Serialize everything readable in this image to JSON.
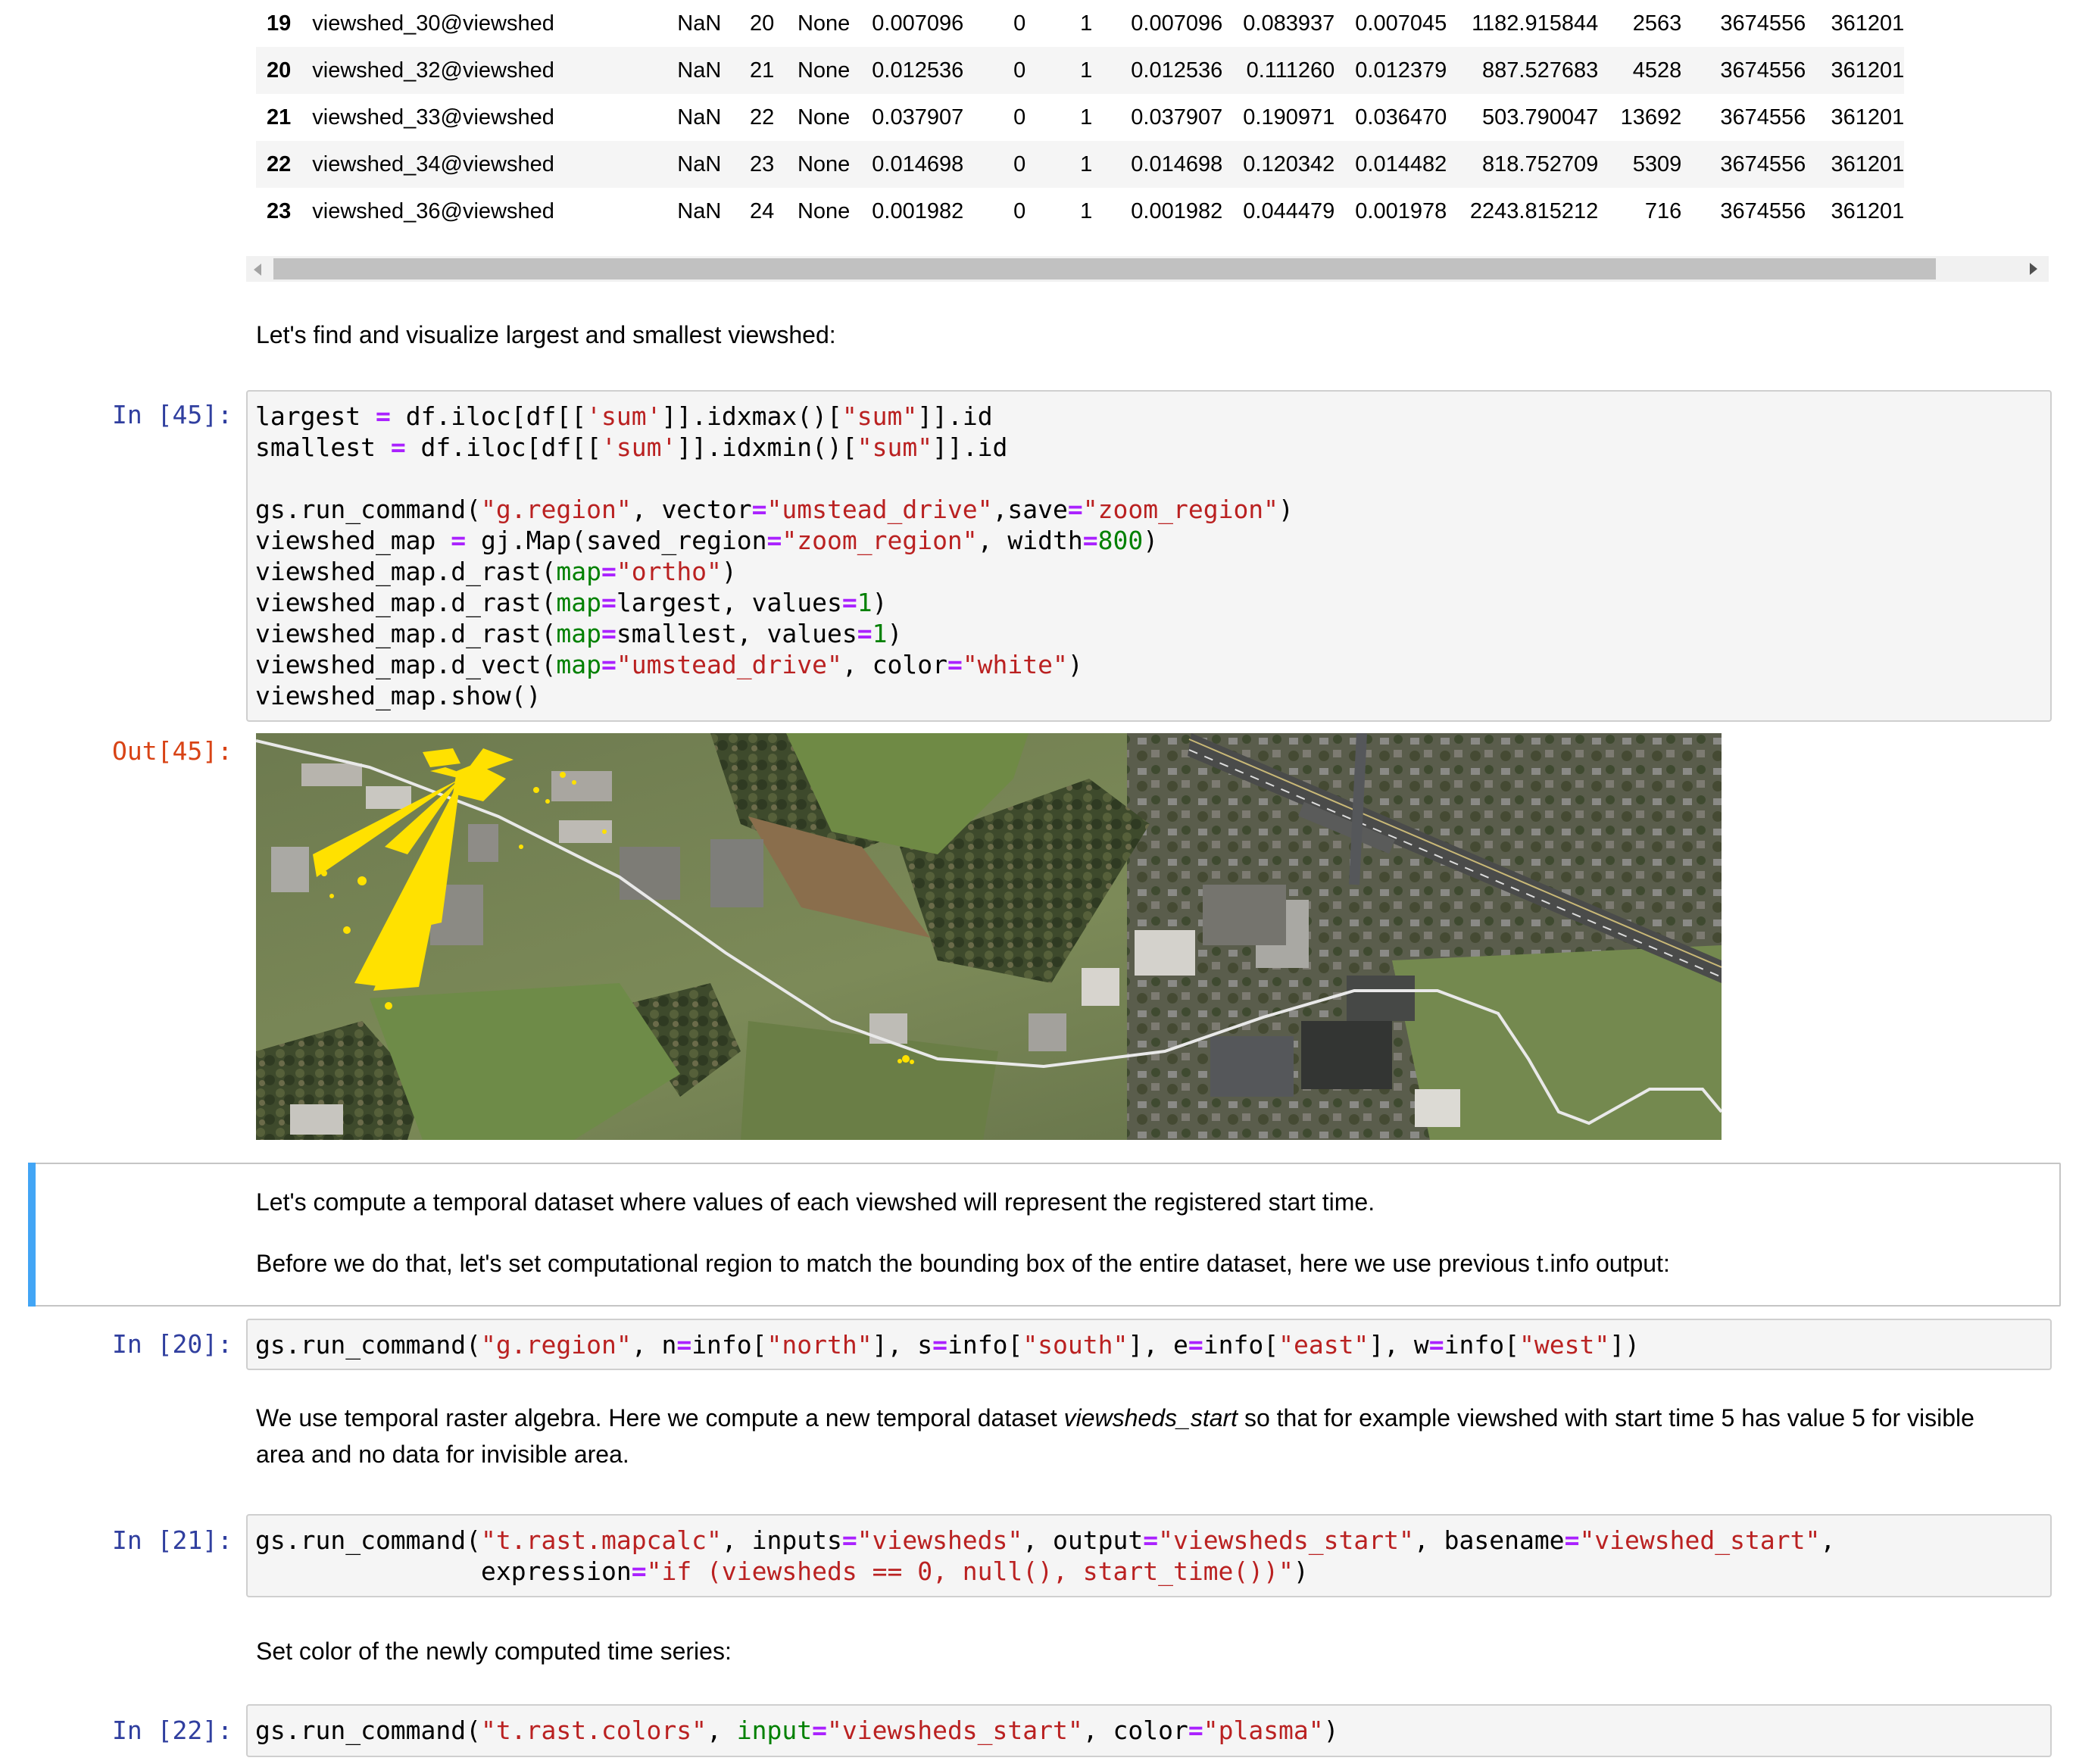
{
  "table": {
    "rows": [
      {
        "idx": "19",
        "name": "viewshed_30@viewshed",
        "c1": "NaN",
        "c2": "20",
        "c3": "None",
        "c4": "0.007096",
        "c5": "0",
        "c6": "1",
        "c7": "0.007096",
        "c8": "0.083937",
        "c9": "0.007045",
        "c10": "1182.915844",
        "c11": "2563",
        "c12": "3674556",
        "c13": "361201"
      },
      {
        "idx": "20",
        "name": "viewshed_32@viewshed",
        "c1": "NaN",
        "c2": "21",
        "c3": "None",
        "c4": "0.012536",
        "c5": "0",
        "c6": "1",
        "c7": "0.012536",
        "c8": "0.111260",
        "c9": "0.012379",
        "c10": "887.527683",
        "c11": "4528",
        "c12": "3674556",
        "c13": "361201"
      },
      {
        "idx": "21",
        "name": "viewshed_33@viewshed",
        "c1": "NaN",
        "c2": "22",
        "c3": "None",
        "c4": "0.037907",
        "c5": "0",
        "c6": "1",
        "c7": "0.037907",
        "c8": "0.190971",
        "c9": "0.036470",
        "c10": "503.790047",
        "c11": "13692",
        "c12": "3674556",
        "c13": "361201"
      },
      {
        "idx": "22",
        "name": "viewshed_34@viewshed",
        "c1": "NaN",
        "c2": "23",
        "c3": "None",
        "c4": "0.014698",
        "c5": "0",
        "c6": "1",
        "c7": "0.014698",
        "c8": "0.120342",
        "c9": "0.014482",
        "c10": "818.752709",
        "c11": "5309",
        "c12": "3674556",
        "c13": "361201"
      },
      {
        "idx": "23",
        "name": "viewshed_36@viewshed",
        "c1": "NaN",
        "c2": "24",
        "c3": "None",
        "c4": "0.001982",
        "c5": "0",
        "c6": "1",
        "c7": "0.001982",
        "c8": "0.044479",
        "c9": "0.001978",
        "c10": "2243.815212",
        "c11": "716",
        "c12": "3674556",
        "c13": "361201"
      }
    ]
  },
  "md1": "Let's find and visualize largest and smallest viewshed:",
  "cell45": {
    "prompt_in": "In [45]:",
    "prompt_out": "Out[45]:"
  },
  "md2": {
    "p1": "Let's compute a temporal dataset where values of each viewshed will represent the registered start time.",
    "p2": "Before we do that, let's set computational region to match the bounding box of the entire dataset, here we use previous t.info output:"
  },
  "cell20": {
    "prompt": "In [20]:"
  },
  "md3": {
    "before": "We use temporal raster algebra. Here we compute a new temporal dataset ",
    "em": "viewsheds_start",
    "after": " so that for example viewshed with start time 5 has value 5 for visible area and no data for invisible area."
  },
  "cell21": {
    "prompt": "In [21]:"
  },
  "md4": "Set color of the newly computed time series:",
  "cell22": {
    "prompt": "In [22]:"
  },
  "colors": {
    "prompt_in": "#303f9f",
    "prompt_out": "#d84315",
    "string": "#ba2121",
    "operator": "#aa22ff",
    "number": "#008000",
    "selected_cell_bar": "#42a5f5"
  }
}
